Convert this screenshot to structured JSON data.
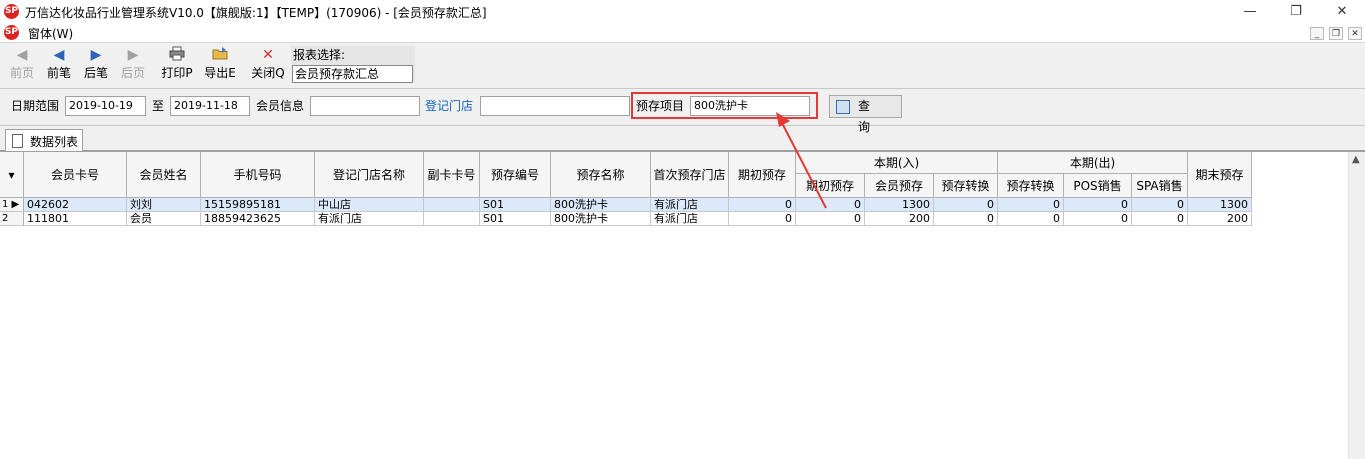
{
  "window": {
    "title": "万信达化妆品行业管理系统V10.0【旗舰版:1】【TEMP】(170906) - [会员预存款汇总]",
    "logo_text": "SP",
    "minimize": "—",
    "restore": "❐",
    "close": "✕"
  },
  "menu": {
    "window_label": "窗体(W)",
    "mdi_min": "_",
    "mdi_restore": "❐",
    "mdi_close": "✕"
  },
  "toolbar": {
    "first_label": "前页",
    "prev_label": "前笔",
    "next_label": "后笔",
    "last_label": "后页",
    "print_label": "打印P",
    "export_label": "导出E",
    "close_label": "关闭Q",
    "report_label": "报表选择:",
    "report_value": "会员预存款汇总"
  },
  "filters": {
    "date_label": "日期范围",
    "date_from": "2019-10-19",
    "to_label": "至",
    "date_to": "2019-11-18",
    "member_label": "会员信息",
    "member_value": "",
    "store_link": "登记门店",
    "store_value": "",
    "prestore_label": "预存项目",
    "prestore_value": "800洗护卡",
    "query_label": "查 询"
  },
  "tabs": {
    "data_list": "数据列表"
  },
  "grid": {
    "columns": {
      "card_no": "会员卡号",
      "name": "会员姓名",
      "phone": "手机号码",
      "store": "登记门店名称",
      "sub_card": "副卡卡号",
      "prestore_no": "预存编号",
      "prestore_name": "预存名称",
      "first_store": "首次预存门店",
      "opening": "期初预存",
      "in_group": "本期(入)",
      "in_opening": "期初预存",
      "in_member": "会员预存",
      "in_transfer": "预存转换",
      "out_group": "本期(出)",
      "out_transfer": "预存转换",
      "out_pos": "POS销售",
      "out_spa": "SPA销售",
      "closing": "期末预存"
    },
    "rows": [
      {
        "idx": "1 ▶",
        "card_no": "042602",
        "name": "刘刘",
        "phone": "15159895181",
        "store": "中山店",
        "sub_card": "",
        "prestore_no": "S01",
        "prestore_name": "800洗护卡",
        "first_store": "有派门店",
        "opening": "0",
        "in_opening": "0",
        "in_member": "1300",
        "in_transfer": "0",
        "out_transfer": "0",
        "out_pos": "0",
        "out_spa": "0",
        "closing": "1300"
      },
      {
        "idx": "2",
        "card_no": "111801",
        "name": "会员",
        "phone": "18859423625",
        "store": "有派门店",
        "sub_card": "",
        "prestore_no": "S01",
        "prestore_name": "800洗护卡",
        "first_store": "有派门店",
        "opening": "0",
        "in_opening": "0",
        "in_member": "200",
        "in_transfer": "0",
        "out_transfer": "0",
        "out_pos": "0",
        "out_spa": "0",
        "closing": "200"
      }
    ]
  },
  "colors": {
    "highlight": "#e53935",
    "link": "#1565c0",
    "selected_row": "#dbe9fb"
  }
}
